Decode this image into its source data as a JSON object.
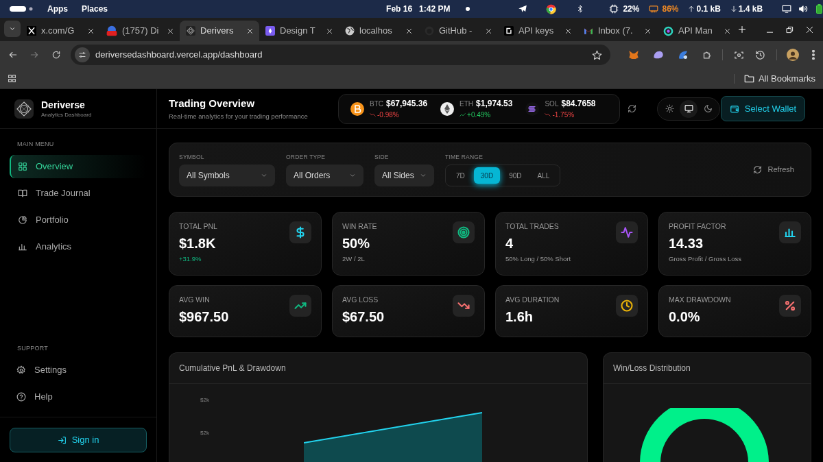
{
  "system_bar": {
    "menus": [
      "Apps",
      "Places"
    ],
    "date": "Feb 16",
    "time": "1:42 PM",
    "cpu": "22%",
    "memory": "86%",
    "upload": "0.1 kB",
    "download": "1.4 kB"
  },
  "tabs": [
    {
      "title": "x.com/G",
      "selected": false,
      "kind": "x"
    },
    {
      "title": "(1757) Di",
      "selected": false,
      "kind": "badge"
    },
    {
      "title": "Derivers",
      "selected": true,
      "kind": "logo"
    },
    {
      "title": "Design T",
      "selected": false,
      "kind": "design"
    },
    {
      "title": "localhos",
      "selected": false,
      "kind": "globe"
    },
    {
      "title": "GitHub -",
      "selected": false,
      "kind": "github"
    },
    {
      "title": "API keys",
      "selected": false,
      "kind": "api"
    },
    {
      "title": "Inbox (7.",
      "selected": false,
      "kind": "mail"
    },
    {
      "title": "API Man",
      "selected": false,
      "kind": "ring"
    }
  ],
  "address_bar": {
    "url": "deriversedashboard.vercel.app/dashboard"
  },
  "bookmarks_bar": {
    "folder": "All Bookmarks"
  },
  "app": {
    "name": "Deriverse",
    "tagline": "Analytics Dashboard",
    "main_menu_heading": "MAIN MENU",
    "main_menu": [
      {
        "label": "Overview",
        "kind": "grid",
        "selected": true
      },
      {
        "label": "Trade Journal",
        "kind": "book",
        "selected": false
      },
      {
        "label": "Portfolio",
        "kind": "pie",
        "selected": false
      },
      {
        "label": "Analytics",
        "kind": "bars",
        "selected": false
      }
    ],
    "support_heading": "SUPPORT",
    "support_menu": [
      {
        "label": "Settings",
        "kind": "gear"
      },
      {
        "label": "Help",
        "kind": "help"
      }
    ],
    "sign_in": "Sign in"
  },
  "header": {
    "title": "Trading Overview",
    "subtitle": "Real-time analytics for your trading performance",
    "tickers": [
      {
        "symbol": "BTC",
        "price": "$67,945.36",
        "change": "-0.98%",
        "kind": "down"
      },
      {
        "symbol": "ETH",
        "price": "$1,974.53",
        "change": "+0.49%",
        "kind": "up"
      },
      {
        "symbol": "SOL",
        "price": "$84.7658",
        "change": "-1.75%",
        "kind": "down"
      }
    ],
    "theme_options": [
      {
        "kind": "light",
        "selected": false
      },
      {
        "kind": "system",
        "selected": true
      },
      {
        "kind": "dark",
        "selected": false
      }
    ],
    "wallet_button": "Select Wallet"
  },
  "filters": {
    "selects": [
      {
        "label": "SYMBOL",
        "value": "All Symbols"
      },
      {
        "label": "ORDER TYPE",
        "value": "All Orders"
      },
      {
        "label": "SIDE",
        "value": "All Sides"
      }
    ],
    "time_range": {
      "label": "TIME RANGE",
      "options": [
        {
          "label": "7D",
          "selected": false
        },
        {
          "label": "30D",
          "selected": true
        },
        {
          "label": "90D",
          "selected": false
        },
        {
          "label": "ALL",
          "selected": false
        }
      ]
    },
    "refresh": "Refresh"
  },
  "stats": [
    {
      "label": "TOTAL PNL",
      "value": "$1.8K",
      "note": "+31.9%",
      "note_positive": true,
      "kind": "dollar",
      "color": "#22d3ee"
    },
    {
      "label": "WIN RATE",
      "value": "50%",
      "note": "2W / 2L",
      "note_positive": false,
      "kind": "target",
      "color": "#10b981"
    },
    {
      "label": "TOTAL TRADES",
      "value": "4",
      "note": "50% Long / 50% Short",
      "note_positive": false,
      "kind": "pulse",
      "color": "#a855f7"
    },
    {
      "label": "PROFIT FACTOR",
      "value": "14.33",
      "note": "Gross Profit / Gross Loss",
      "note_positive": false,
      "kind": "bars",
      "color": "#22d3ee"
    },
    {
      "label": "AVG WIN",
      "value": "$967.50",
      "kind": "trend-up",
      "color": "#10b981"
    },
    {
      "label": "AVG LOSS",
      "value": "$67.50",
      "kind": "trend-down",
      "color": "#f87171"
    },
    {
      "label": "AVG DURATION",
      "value": "1.6h",
      "kind": "clock",
      "color": "#eab308"
    },
    {
      "label": "MAX DRAWDOWN",
      "value": "0.0%",
      "kind": "percent",
      "color": "#f87171"
    }
  ],
  "pnl_chart": {
    "title": "Cumulative PnL & Drawdown",
    "y_tick_labels": [
      "$2k",
      "$2k"
    ]
  },
  "distribution_chart": {
    "title": "Win/Loss Distribution"
  }
}
